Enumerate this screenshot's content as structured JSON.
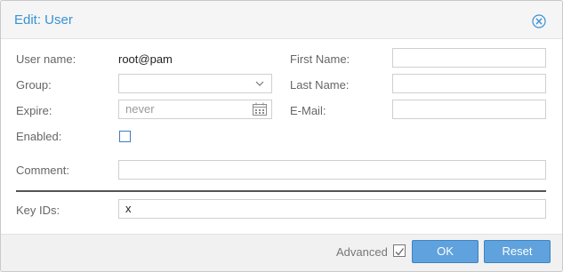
{
  "dialog": {
    "title": "Edit: User",
    "close_icon": "close-circle-icon"
  },
  "form": {
    "username_label": "User name:",
    "username_value": "root@pam",
    "group_label": "Group:",
    "group_value": "",
    "expire_label": "Expire:",
    "expire_placeholder": "never",
    "enabled_label": "Enabled:",
    "enabled_checked": false,
    "comment_label": "Comment:",
    "comment_value": "",
    "firstname_label": "First Name:",
    "firstname_value": "",
    "lastname_label": "Last Name:",
    "lastname_value": "",
    "email_label": "E-Mail:",
    "email_value": "",
    "keyids_label": "Key IDs:",
    "keyids_value": "x"
  },
  "footer": {
    "advanced_label": "Advanced",
    "advanced_checked": true,
    "ok_label": "OK",
    "reset_label": "Reset"
  },
  "colors": {
    "accent": "#3892d4",
    "button": "#5fa2dd"
  }
}
